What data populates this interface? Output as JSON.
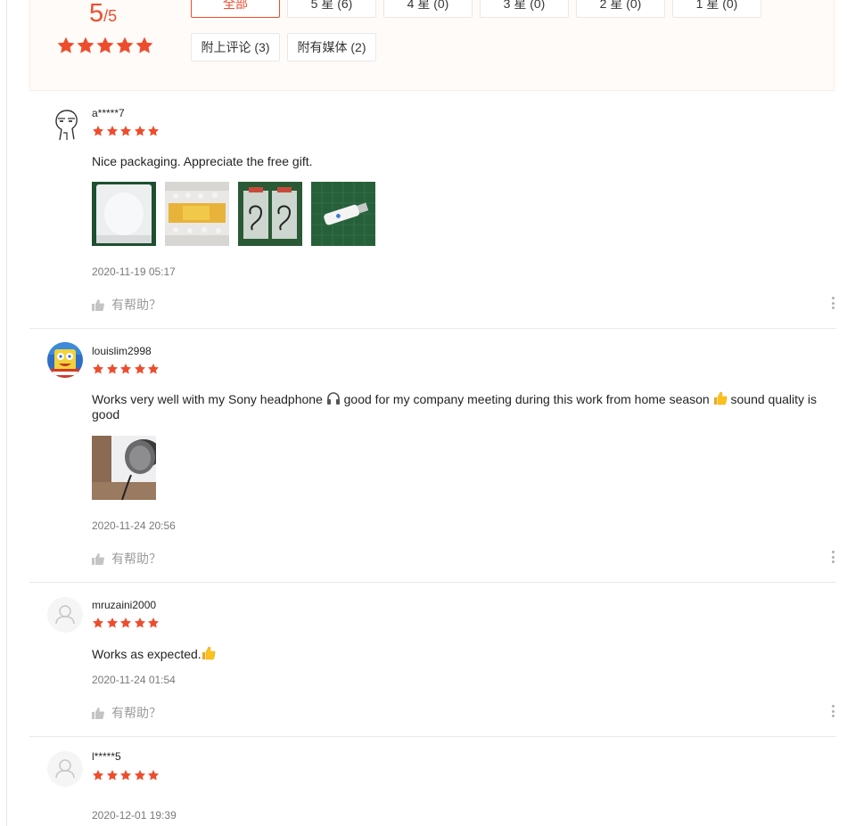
{
  "overview": {
    "score": "5",
    "score_max": "/5",
    "filters": [
      {
        "label": "全部"
      },
      {
        "label": "5 星 (6)"
      },
      {
        "label": "4 星 (0)"
      },
      {
        "label": "3 星 (0)"
      },
      {
        "label": "2 星 (0)"
      },
      {
        "label": "1 星 (0)"
      },
      {
        "label": "附上评论 (3)"
      },
      {
        "label": "附有媒体 (2)"
      }
    ]
  },
  "colors": {
    "accent": "#ee4d2d",
    "panel_bg": "#fffbf8"
  },
  "reviews": [
    {
      "username": "a*****7",
      "rating": 5,
      "comment": "Nice packaging. Appreciate the free gift.",
      "date": "2020-11-19 05:17",
      "helpful_label": "有帮助？",
      "avatar_icon": "user-drawing-avatar"
    },
    {
      "username": "louislim2998",
      "rating": 5,
      "comment_part1": "Works very well with my Sony headphone ",
      "comment_part2": " good for my company meeting during this work from home season ",
      "comment_part3": " sound quality is good",
      "date": "2020-11-24 20:56",
      "helpful_label": "有帮助？",
      "avatar_icon": "cartoon-avatar"
    },
    {
      "username": "mruzaini2000",
      "rating": 5,
      "comment": "Works as expected.",
      "date": "2020-11-24 01:54",
      "helpful_label": "有帮助？",
      "avatar_icon": "default-user-icon"
    },
    {
      "username": "l*****5",
      "rating": 5,
      "date": "2020-12-01 19:39",
      "avatar_icon": "default-user-icon"
    }
  ]
}
